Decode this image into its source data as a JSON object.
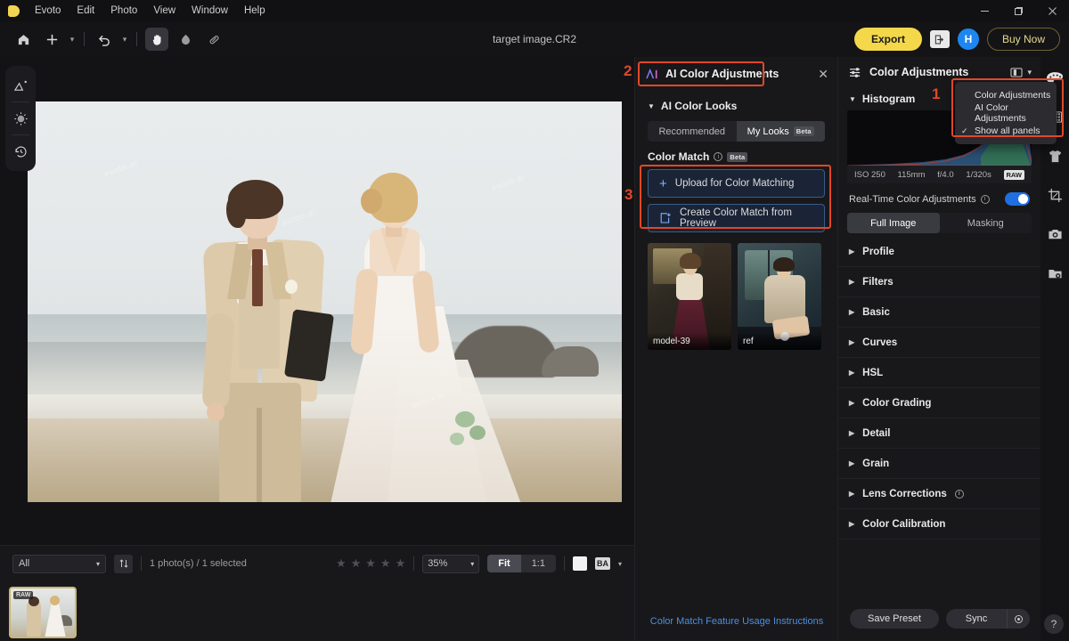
{
  "app": {
    "name": "Evoto",
    "document_title": "target image.CR2"
  },
  "menubar": {
    "items": [
      "Evoto",
      "Edit",
      "Photo",
      "View",
      "Window",
      "Help"
    ]
  },
  "window_controls": {
    "minimize": "–",
    "maximize": "❐",
    "close": "✕"
  },
  "toolbar": {
    "home_icon": "home-icon",
    "add_icon": "plus-icon",
    "undo_icon": "undo-icon",
    "hand_icon": "hand-tool-icon",
    "dodge_icon": "dodge-tool-icon",
    "heal_icon": "heal-tool-icon",
    "export_label": "Export",
    "share_icon": "share-icon",
    "avatar_initial": "H",
    "buy_now_label": "Buy Now"
  },
  "left_rail": {
    "items": [
      {
        "name": "retouch-icon",
        "label": "Retouch"
      },
      {
        "name": "light-icon",
        "label": "Light"
      },
      {
        "name": "history-icon",
        "label": "History"
      }
    ]
  },
  "right_rail": {
    "items": [
      {
        "name": "palette-icon",
        "label": "Color",
        "selected": true
      },
      {
        "name": "film-grid-icon",
        "label": "Texture"
      },
      {
        "name": "tshirt-icon",
        "label": "Clothes"
      },
      {
        "name": "crop-icon",
        "label": "Crop"
      },
      {
        "name": "camera-icon",
        "label": "Camera"
      },
      {
        "name": "folder-eye-icon",
        "label": "Presets"
      }
    ],
    "help_label": "?"
  },
  "canvas": {
    "info_icon": "info-icon",
    "compare_icon": "before-after-icon",
    "watermarks": [
      "evoto.ai",
      "evoto.ai",
      "evoto.ai",
      "evoto.ai"
    ]
  },
  "filmstrip": {
    "filter_value": "All",
    "sort_icon": "sort-icon",
    "count_label": "1 photo(s) / 1 selected",
    "rating_stars": 5,
    "zoom_value": "35%",
    "fit_label": "Fit",
    "one_to_one_label": "1:1",
    "background_swatch": "background-color-swatch",
    "compare_mode_label": "BA",
    "thumbnails": [
      {
        "badge": "RAW",
        "selected": true
      }
    ]
  },
  "ai_panel": {
    "logo": "Ai",
    "title": "AI Color Adjustments",
    "close_icon": "close-icon",
    "section_ai_color_looks": "AI Color Looks",
    "tabs": [
      {
        "label": "Recommended",
        "active": false
      },
      {
        "label": "My Looks",
        "badge": "Beta",
        "active": true
      }
    ],
    "color_match": {
      "title": "Color Match",
      "badge": "Beta",
      "info_icon": "info-icon"
    },
    "buttons": [
      {
        "label": "Upload for Color Matching",
        "icon": "plus-icon"
      },
      {
        "label": "Create Color Match from Preview",
        "icon": "export-preview-icon"
      }
    ],
    "references": [
      {
        "label": "model-39"
      },
      {
        "label": "ref"
      }
    ],
    "footer_link": "Color Match Feature Usage Instructions"
  },
  "color_panel": {
    "header_icon": "sliders-icon",
    "title": "Color Adjustments",
    "layout_icon": "panel-layout-icon",
    "chevron_icon": "chevron-down-icon",
    "histogram": {
      "section_label": "Histogram",
      "iso": "ISO 250",
      "focal_length": "115mm",
      "aperture": "f/4.0",
      "shutter": "1/320s",
      "format_badge": "RAW"
    },
    "realtime": {
      "label": "Real-Time Color Adjustments",
      "info_icon": "info-icon",
      "enabled": true
    },
    "mode_tabs": [
      {
        "label": "Full Image",
        "active": true
      },
      {
        "label": "Masking",
        "active": false
      }
    ],
    "sections": [
      {
        "label": "Profile"
      },
      {
        "label": "Filters"
      },
      {
        "label": "Basic"
      },
      {
        "label": "Curves"
      },
      {
        "label": "HSL"
      },
      {
        "label": "Color Grading"
      },
      {
        "label": "Detail"
      },
      {
        "label": "Grain"
      },
      {
        "label": "Lens Corrections",
        "info_icon": "info-icon"
      },
      {
        "label": "Color Calibration"
      }
    ],
    "footer": {
      "save_preset_label": "Save Preset",
      "sync_label": "Sync",
      "sync_options_icon": "settings-icon"
    }
  },
  "dropdown": {
    "items": [
      {
        "label": "Color Adjustments",
        "checked": false
      },
      {
        "label": "AI Color Adjustments",
        "checked": false
      },
      {
        "label": "Show all panels",
        "checked": true
      }
    ],
    "check_glyph": "✓"
  },
  "annotations": {
    "markers": [
      "1",
      "2",
      "3"
    ],
    "color": "#e0482a"
  }
}
